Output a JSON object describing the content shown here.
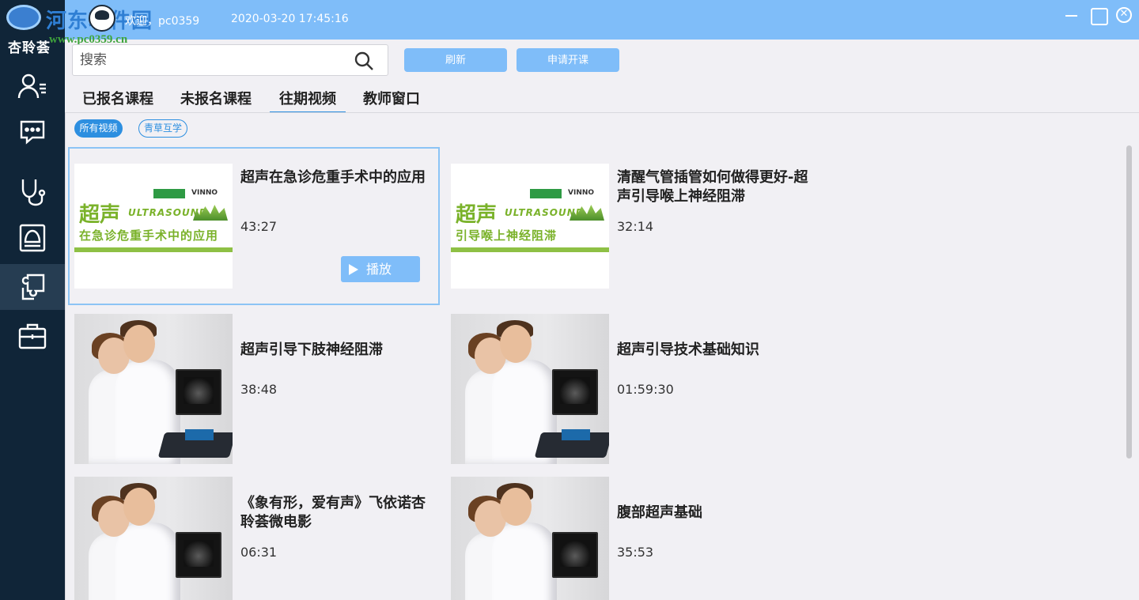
{
  "app": {
    "logo_text": "杏聆荟",
    "watermark": "河东软件园",
    "watermark_url": "www.pc0359.cn",
    "welcome": "欢迎，pc0359",
    "datetime": "2020-03-20 17:45:16"
  },
  "window": {
    "close_glyph": "✕"
  },
  "sidebar": {
    "items": [
      {
        "icon": "user-list-icon"
      },
      {
        "icon": "chat-icon"
      },
      {
        "icon": "stethoscope-icon"
      },
      {
        "icon": "ultrasound-icon"
      },
      {
        "icon": "puzzle-icon",
        "active": true
      },
      {
        "icon": "briefcase-icon"
      }
    ]
  },
  "toolbar": {
    "search_placeholder": "搜索",
    "refresh_label": "刷新",
    "apply_label": "申请开课"
  },
  "tabs": [
    {
      "label": "已报名课程"
    },
    {
      "label": "未报名课程"
    },
    {
      "label": "往期视频",
      "active": true
    },
    {
      "label": "教师窗口"
    }
  ],
  "filters": [
    {
      "label": "所有视频",
      "active": true
    },
    {
      "label": "青草互学"
    }
  ],
  "videos": [
    {
      "title": "超声在急诊危重手术中的应用",
      "duration": "43:27",
      "thumb": "ultrasound",
      "thumb_big": "超声",
      "thumb_ultra": "ULTRASOUND",
      "thumb_sub": "在急诊危重手术中的应用",
      "thumb_logo": "VINNO",
      "selected": true,
      "play_label": "播放"
    },
    {
      "title": "清醒气管插管如何做得更好-超声引导喉上神经阻滞",
      "duration": "32:14",
      "thumb": "ultrasound",
      "thumb_big": "超声",
      "thumb_ultra": "ULTRASOUND",
      "thumb_sub": "引导喉上神经阻滞",
      "thumb_logo": "VINNO"
    },
    {
      "title": "超声引导下肢神经阻滞",
      "duration": "38:48",
      "thumb": "photo"
    },
    {
      "title": "超声引导技术基础知识",
      "duration": "01:59:30",
      "thumb": "photo"
    },
    {
      "title": "《象有形，爱有声》飞依诺杏聆荟微电影",
      "duration": "06:31",
      "thumb": "photo"
    },
    {
      "title": "腹部超声基础",
      "duration": "35:53",
      "thumb": "photo"
    }
  ],
  "colors": {
    "titlebar": "#7fbdf9",
    "sidebar": "#102538",
    "accent": "#2d8fe0",
    "button": "#7fbdf9"
  }
}
